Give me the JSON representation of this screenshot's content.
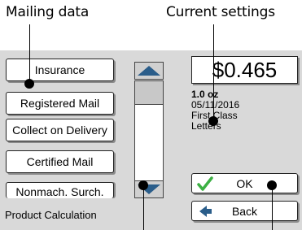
{
  "callouts": {
    "mailing_data": "Mailing data",
    "current_settings": "Current settings"
  },
  "options": [
    {
      "label": "Insurance"
    },
    {
      "label": "Registered Mail"
    },
    {
      "label": "Collect on Delivery"
    },
    {
      "label": "Certified Mail"
    },
    {
      "label": "Nonmach. Surch."
    }
  ],
  "scrollbar": {
    "up_icon": "triangle-up",
    "down_icon": "triangle-down"
  },
  "postage": {
    "amount": "$0.465"
  },
  "settings": {
    "weight": "1.0 oz",
    "date": "05/11/2016",
    "class": "First Class",
    "format": "Letters"
  },
  "buttons": {
    "ok": "OK",
    "back": "Back",
    "ok_icon": "check-icon",
    "back_icon": "back-arrow-icon"
  },
  "status": {
    "text": "Product Calculation"
  },
  "colors": {
    "check": "#3cb043",
    "scroll_arrow": "#2a5d8a",
    "back_arrow": "#2a5d8a",
    "screen_bg": "#d9d9d9"
  }
}
